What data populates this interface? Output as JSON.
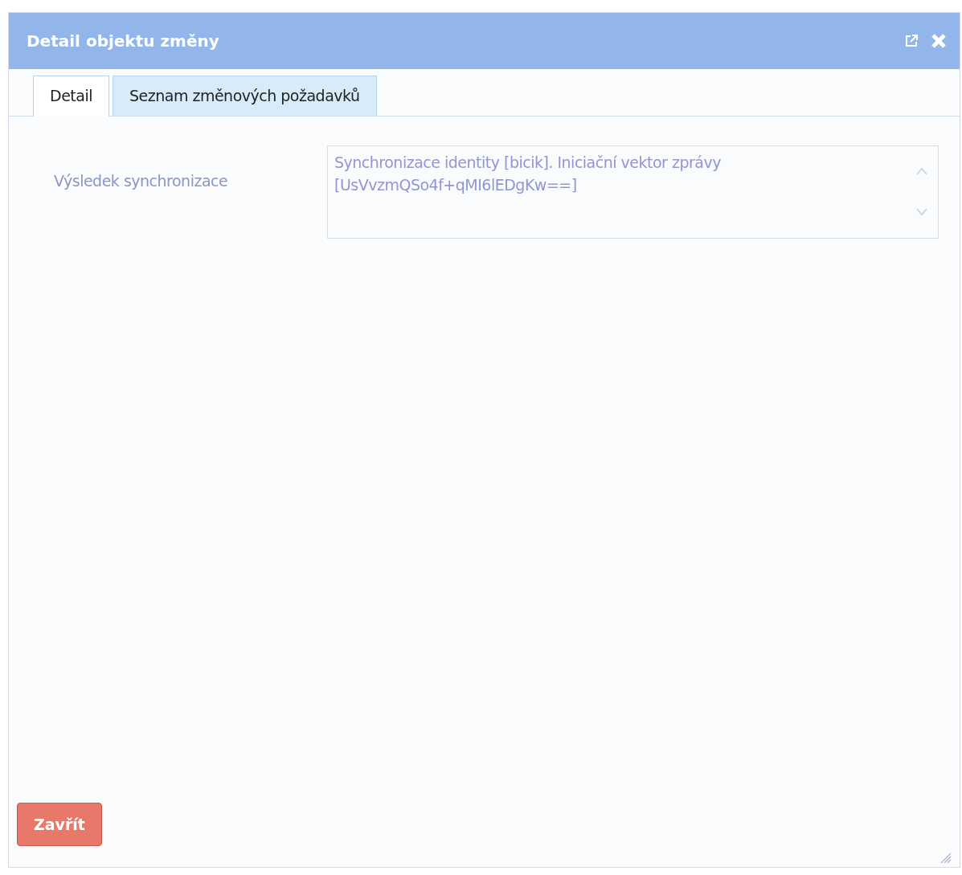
{
  "window": {
    "title": "Detail objektu změny"
  },
  "tabs": [
    {
      "label": "Detail",
      "selected": true
    },
    {
      "label": "Seznam změnových požadavků",
      "selected": false
    }
  ],
  "fields": [
    {
      "label": "Výsledek synchronizace",
      "value": "Synchronizace identity [bicik]. Iniciační vektor zprávy\n[UsVvzmQSo4f+qMI6lEDgKw==]",
      "disabled": true
    }
  ],
  "buttons": [
    {
      "label": "Zavřít"
    }
  ]
}
